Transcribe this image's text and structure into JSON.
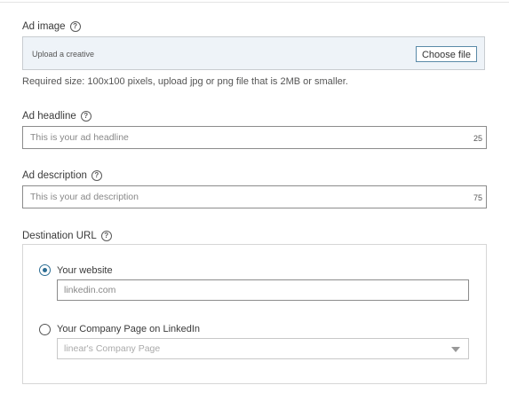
{
  "ad_image": {
    "label": "Ad image",
    "help_glyph": "?",
    "upload_placeholder": "Upload a creative",
    "choose_file_label": "Choose file",
    "requirements": "Required size: 100x100 pixels, upload jpg or png file that is 2MB or smaller."
  },
  "ad_headline": {
    "label": "Ad headline",
    "help_glyph": "?",
    "placeholder": "This is your ad headline",
    "char_count": "25"
  },
  "ad_description": {
    "label": "Ad description",
    "help_glyph": "?",
    "placeholder": "This is your ad description",
    "char_count": "75"
  },
  "destination_url": {
    "label": "Destination URL",
    "help_glyph": "?",
    "options": [
      {
        "label": "Your website",
        "selected": true,
        "input_placeholder": "linkedin.com"
      },
      {
        "label": "Your Company Page on LinkedIn",
        "selected": false,
        "select_value": "linear's Company Page"
      }
    ]
  },
  "colors": {
    "accent": "#2d6e94",
    "upload_bg": "#eef3f8"
  }
}
